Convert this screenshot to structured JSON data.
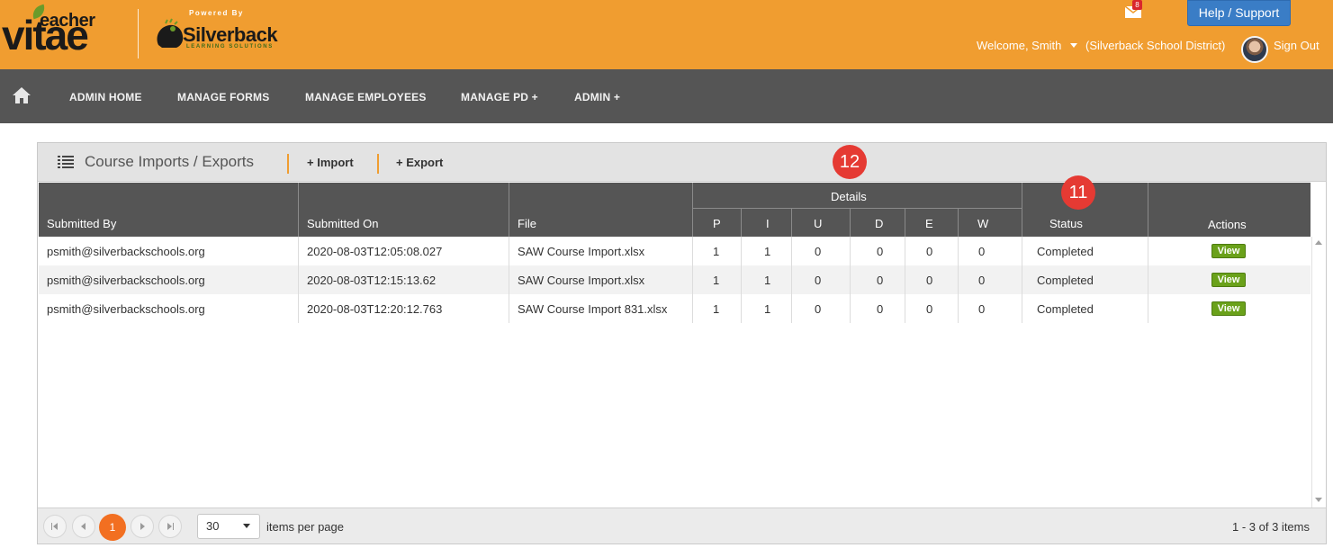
{
  "header": {
    "logo_teacher": "eacher",
    "logo_vitae": "vitae",
    "powered_by": "Powered By",
    "partner_name": "Silverback",
    "partner_sub": "LEARNING SOLUTIONS",
    "mail_count": "8",
    "help_label": "Help / Support",
    "welcome": "Welcome, Smith",
    "district": "(Silverback School District)",
    "signout": "Sign Out",
    "bg_color": "#f09d30"
  },
  "nav": {
    "items": [
      "ADMIN HOME",
      "MANAGE FORMS",
      "MANAGE EMPLOYEES",
      "MANAGE PD +",
      "ADMIN +"
    ]
  },
  "panel": {
    "title": "Course Imports / Exports",
    "import_label": "+ Import",
    "export_label": "+ Export"
  },
  "badges": [
    "12",
    "11"
  ],
  "grid": {
    "headers": {
      "submitted_by": "Submitted By",
      "submitted_on": "Submitted On",
      "file": "File",
      "details": "Details",
      "p": "P",
      "i": "I",
      "u": "U",
      "d": "D",
      "e": "E",
      "w": "W",
      "status": "Status",
      "actions": "Actions"
    },
    "rows": [
      {
        "by": "psmith@silverbackschools.org",
        "on": "2020-08-03T12:05:08.027",
        "file": "SAW Course Import.xlsx",
        "p": "1",
        "i": "1",
        "u": "0",
        "d": "0",
        "e": "0",
        "w": "0",
        "status": "Completed",
        "action": "View"
      },
      {
        "by": "psmith@silverbackschools.org",
        "on": "2020-08-03T12:15:13.62",
        "file": "SAW Course Import.xlsx",
        "p": "1",
        "i": "1",
        "u": "0",
        "d": "0",
        "e": "0",
        "w": "0",
        "status": "Completed",
        "action": "View"
      },
      {
        "by": "psmith@silverbackschools.org",
        "on": "2020-08-03T12:20:12.763",
        "file": "SAW Course Import 831.xlsx",
        "p": "1",
        "i": "1",
        "u": "0",
        "d": "0",
        "e": "0",
        "w": "0",
        "status": "Completed",
        "action": "View"
      }
    ]
  },
  "pager": {
    "current_page": "1",
    "page_size": "30",
    "items_per_page": "items per page",
    "info": "1 - 3 of 3 items"
  }
}
